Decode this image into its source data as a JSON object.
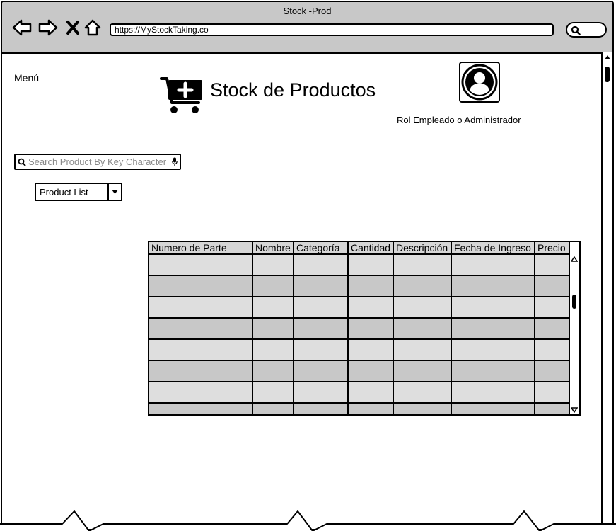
{
  "window": {
    "title": "Stock -Prod"
  },
  "browser": {
    "url": "https://MyStockTaking.co",
    "icons": [
      "back-arrow-icon",
      "forward-arrow-icon",
      "close-x-icon",
      "home-icon",
      "search-icon"
    ]
  },
  "header": {
    "menu_label": "Menú",
    "title": "Stock de Productos",
    "cart_icon": "shopping-cart-plus-icon",
    "avatar_icon": "user-avatar-icon",
    "role_label": "Rol Empleado o Administrador"
  },
  "search": {
    "placeholder": "Search Product By Key Character",
    "value": ""
  },
  "view_select": {
    "selected": "Product List"
  },
  "table": {
    "columns": [
      "Numero de Parte",
      "Nombre",
      "Categoría",
      "Cantidad",
      "Descripción",
      "Fecha de Ingreso",
      "Precio"
    ],
    "rows": [
      [
        "",
        "",
        "",
        "",
        "",
        "",
        ""
      ],
      [
        "",
        "",
        "",
        "",
        "",
        "",
        ""
      ],
      [
        "",
        "",
        "",
        "",
        "",
        "",
        ""
      ],
      [
        "",
        "",
        "",
        "",
        "",
        "",
        ""
      ],
      [
        "",
        "",
        "",
        "",
        "",
        "",
        ""
      ],
      [
        "",
        "",
        "",
        "",
        "",
        "",
        ""
      ],
      [
        "",
        "",
        "",
        "",
        "",
        "",
        ""
      ],
      [
        "",
        "",
        "",
        "",
        "",
        "",
        ""
      ]
    ]
  },
  "colors": {
    "chrome": "#c8c8c8",
    "header_cell": "#d6d6d6",
    "row_light": "#dedede",
    "row_dark": "#c8c8c8",
    "placeholder": "#8a8a8a"
  }
}
